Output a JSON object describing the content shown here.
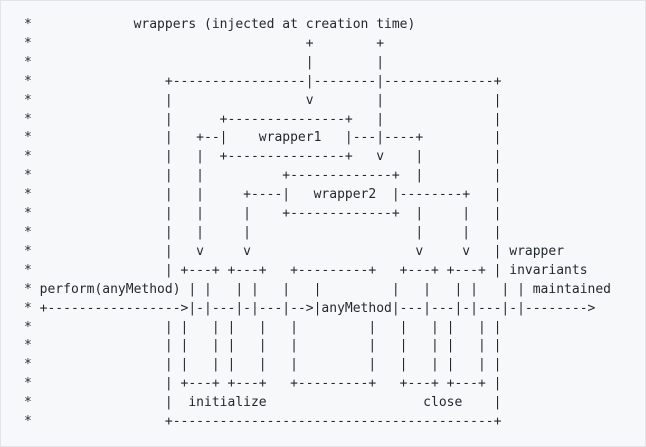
{
  "diagram": {
    "lines": [
      "*             wrappers (injected at creation time)",
      "*                                   +        +",
      "*                                   |        |",
      "*                 +-----------------|--------|--------------+",
      "*                 |                 v        |              |",
      "*                 |      +---------------+   |              |",
      "*                 |   +--|    wrapper1   |---|----+         |",
      "*                 |   |  +---------------+   v    |         |",
      "*                 |   |          +-------------+  |         |",
      "*                 |   |     +----|   wrapper2  |--------+   |",
      "*                 |   |     |    +-------------+  |     |   |",
      "*                 |   |     |                     |     |   |",
      "*                 |   v     v                     v     v   | wrapper",
      "*                 | +---+ +---+   +---------+   +---+ +---+ | invariants",
      "* perform(anyMethod) | |   | |   |   |         |   |   | |   | | maintained",
      "* +----------------->|-|---|-|---|-->|anyMethod|---|---|-|---|-|-------->",
      "*                 | |   | |   |   |         |   |   | |   | |",
      "*                 | |   | |   |   |         |   |   | |   | |",
      "*                 | |   | |   |   |         |   |   | |   | |",
      "*                 | +---+ +---+   +---------+   +---+ +---+ |",
      "*                 |  initialize                    close    |",
      "*                 +-----------------------------------------+"
    ]
  }
}
